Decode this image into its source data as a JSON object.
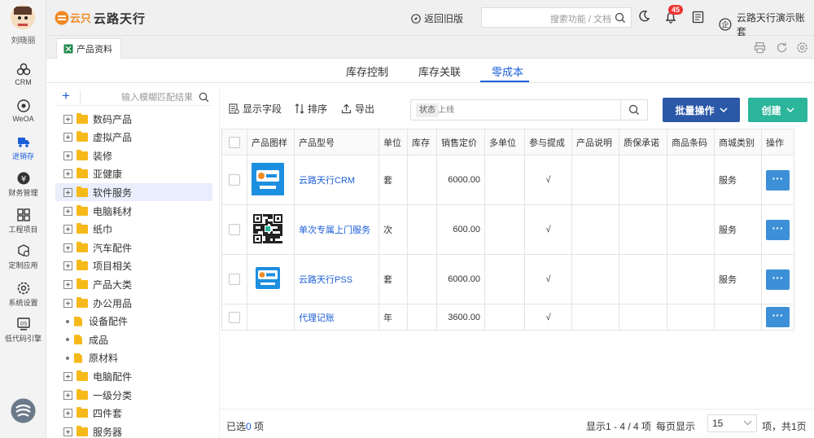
{
  "user": {
    "name": "刘晓丽"
  },
  "nav": [
    {
      "label": "CRM",
      "icon": "crm-icon"
    },
    {
      "label": "WeOA",
      "icon": "weoa-icon"
    },
    {
      "label": "进销存",
      "icon": "truck-icon",
      "active": true
    },
    {
      "label": "财务管理",
      "icon": "finance-icon"
    },
    {
      "label": "工程项目",
      "icon": "grid-icon"
    },
    {
      "label": "定制应用",
      "icon": "custom-app-icon"
    },
    {
      "label": "系统设置",
      "icon": "gear-icon"
    },
    {
      "label": "低代码引擎",
      "icon": "lowcode-icon"
    }
  ],
  "header": {
    "logo_text": "云路天行",
    "old_version": "返回旧版",
    "search_placeholder": "搜索功能 / 文档",
    "notification_count": "45",
    "account": "云路天行演示账套"
  },
  "page_tab": "产品资料",
  "subtabs": [
    "库存控制",
    "库存关联",
    "零成本"
  ],
  "tree": {
    "search_placeholder": "输入模糊匹配结果",
    "items": [
      {
        "label": "数码产品",
        "type": "folder"
      },
      {
        "label": "虚拟产品",
        "type": "folder"
      },
      {
        "label": "装修",
        "type": "folder"
      },
      {
        "label": "亚健康",
        "type": "folder"
      },
      {
        "label": "软件服务",
        "type": "folder",
        "selected": true
      },
      {
        "label": "电脑耗材",
        "type": "folder"
      },
      {
        "label": "纸巾",
        "type": "folder"
      },
      {
        "label": "汽车配件",
        "type": "folder"
      },
      {
        "label": "项目相关",
        "type": "folder"
      },
      {
        "label": "产品大类",
        "type": "folder"
      },
      {
        "label": "办公用品",
        "type": "folder"
      },
      {
        "label": "设备配件",
        "type": "file"
      },
      {
        "label": "成品",
        "type": "file"
      },
      {
        "label": "原材料",
        "type": "file"
      },
      {
        "label": "电脑配件",
        "type": "folder"
      },
      {
        "label": "一级分类",
        "type": "folder"
      },
      {
        "label": "四件套",
        "type": "folder"
      },
      {
        "label": "服务器",
        "type": "folder"
      }
    ]
  },
  "toolbar": {
    "show_fields": "显示字段",
    "sort": "排序",
    "export": "导出",
    "filter_chip": "状态",
    "filter_value": "上线",
    "batch": "批量操作",
    "create": "创建"
  },
  "table": {
    "columns": [
      "产品图样",
      "产品型号",
      "单位",
      "库存",
      "销售定价",
      "多单位",
      "参与提成",
      "产品说明",
      "质保承诺",
      "商品条码",
      "商城类别",
      "操作"
    ],
    "rows": [
      {
        "image": "crm-logo",
        "model": "云路天行CRM",
        "unit": "套",
        "stock": "",
        "price": "6000.00",
        "multi": "",
        "commission": "√",
        "desc": "",
        "warranty": "",
        "barcode": "",
        "category": "服务"
      },
      {
        "image": "qrcode",
        "model": "单次专属上门服务",
        "unit": "次",
        "stock": "",
        "price": "600.00",
        "multi": "",
        "commission": "√",
        "desc": "",
        "warranty": "",
        "barcode": "",
        "category": "服务"
      },
      {
        "image": "pss-logo",
        "model": "云路天行PSS",
        "unit": "套",
        "stock": "",
        "price": "6000.00",
        "multi": "",
        "commission": "√",
        "desc": "",
        "warranty": "",
        "barcode": "",
        "category": "服务"
      },
      {
        "image": "",
        "model": "代理记账",
        "unit": "年",
        "stock": "",
        "price": "3600.00",
        "multi": "",
        "commission": "√",
        "desc": "",
        "warranty": "",
        "barcode": "",
        "category": ""
      }
    ]
  },
  "footer": {
    "selected_prefix": "已选",
    "selected_count": "0",
    "selected_suffix": "项",
    "range": "显示1 - 4 / 4 项",
    "per_page_label": "每页显示",
    "per_page": "15",
    "tail": "项，共1页"
  }
}
